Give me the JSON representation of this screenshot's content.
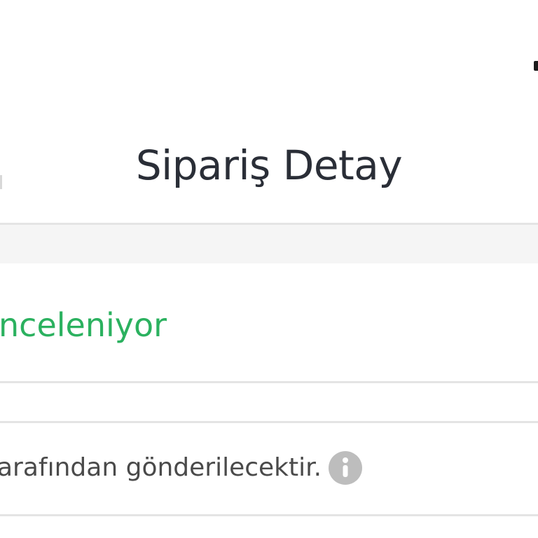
{
  "header": {
    "title": "Sipariş Detay"
  },
  "order_status": {
    "text": "nceleniyor",
    "color": "#2bb15f"
  },
  "shipping_info": {
    "text": "arafından gönderilecektir.",
    "icon": "info-icon"
  },
  "colors": {
    "title": "#2a2e37",
    "status": "#2bb15f",
    "divider": "#e4e4e4",
    "band": "#f5f5f5",
    "info_icon": "#bdbdbd"
  }
}
